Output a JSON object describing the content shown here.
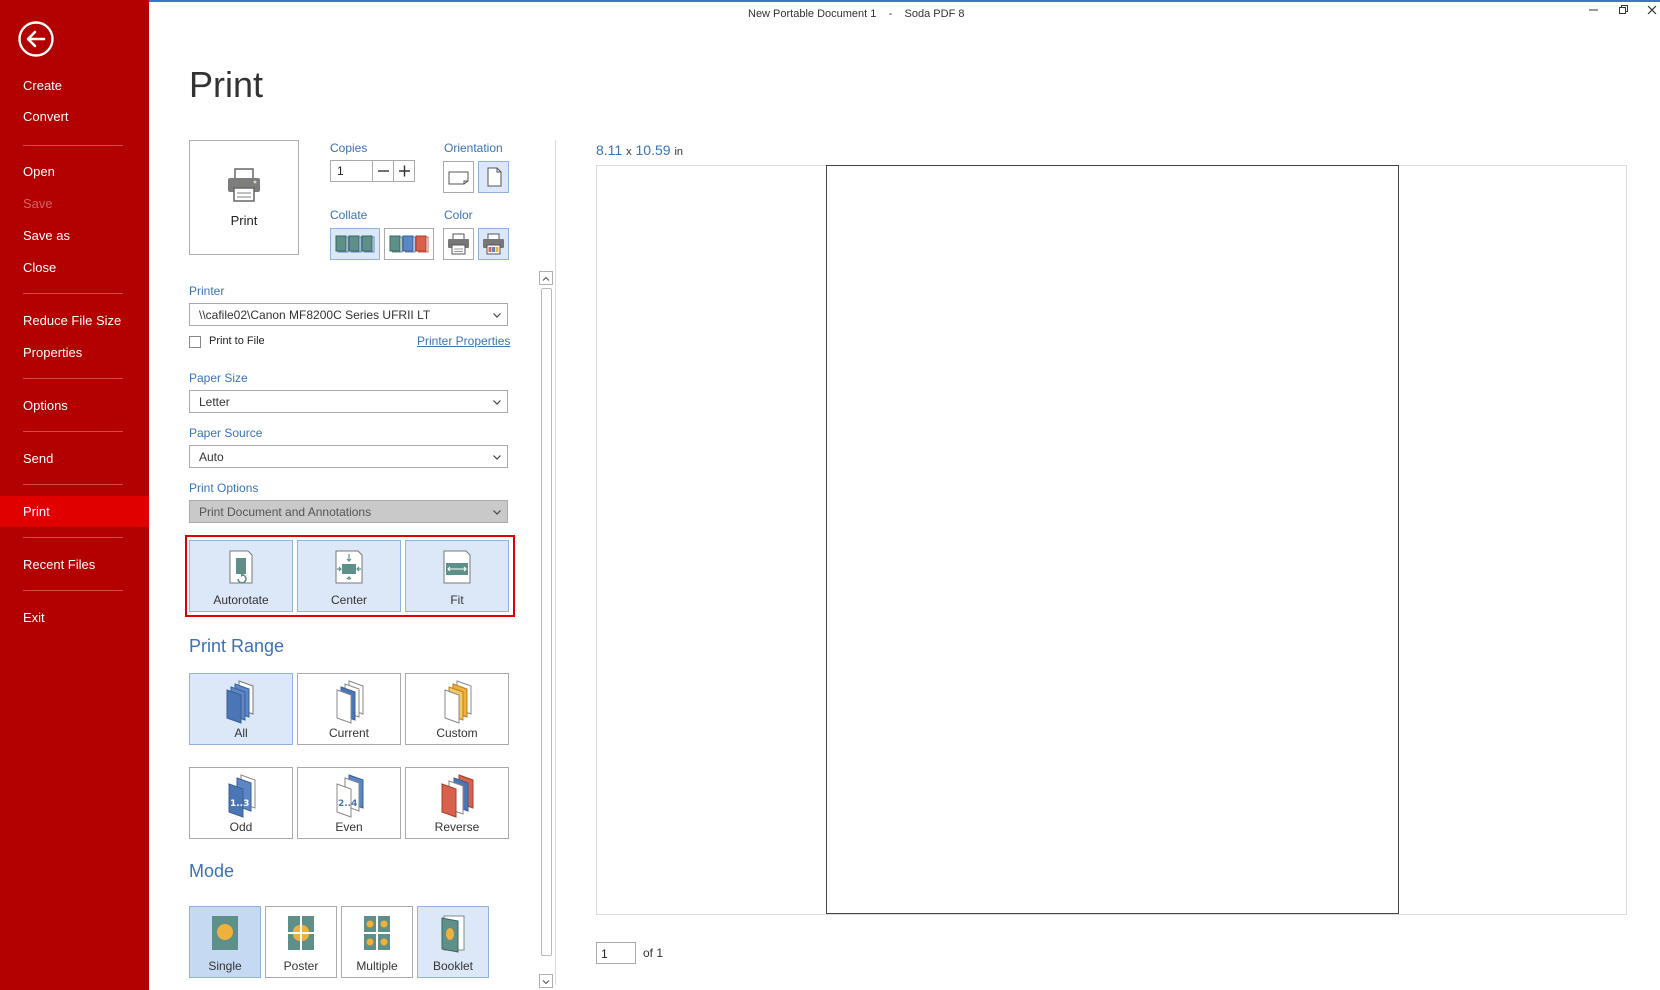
{
  "window": {
    "document_name": "New Portable Document 1",
    "separator": "-",
    "app_name": "Soda PDF 8"
  },
  "sidebar": {
    "items": [
      {
        "label": "Create",
        "enabled": true
      },
      {
        "label": "Convert",
        "enabled": true
      },
      {
        "label": "Open",
        "enabled": true
      },
      {
        "label": "Save",
        "enabled": false
      },
      {
        "label": "Save as",
        "enabled": true
      },
      {
        "label": "Close",
        "enabled": true
      },
      {
        "label": "Reduce File Size",
        "enabled": true
      },
      {
        "label": "Properties",
        "enabled": true
      },
      {
        "label": "Options",
        "enabled": true
      },
      {
        "label": "Send",
        "enabled": true
      },
      {
        "label": "Print",
        "enabled": true,
        "active": true
      },
      {
        "label": "Recent Files",
        "enabled": true
      },
      {
        "label": "Exit",
        "enabled": true
      }
    ],
    "colors": {
      "background": "#b30000",
      "active": "#e00000"
    }
  },
  "print_panel": {
    "title": "Print",
    "print_button_label": "Print",
    "copies": {
      "label": "Copies",
      "value": "1"
    },
    "orientation": {
      "label": "Orientation",
      "selected": "portrait"
    },
    "collate": {
      "label": "Collate",
      "selected": "collated"
    },
    "color": {
      "label": "Color",
      "selected": "color"
    },
    "printer": {
      "label": "Printer",
      "value": "\\\\cafile02\\Canon MF8200C Series UFRII LT",
      "print_to_file_label": "Print to File",
      "print_to_file_checked": false,
      "properties_link": "Printer Properties"
    },
    "paper_size": {
      "label": "Paper Size",
      "value": "Letter"
    },
    "paper_source": {
      "label": "Paper Source",
      "value": "Auto"
    },
    "print_options": {
      "label": "Print Options",
      "value": "Print Document and Annotations"
    },
    "layout_options": [
      {
        "label": "Autorotate",
        "selected": true
      },
      {
        "label": "Center",
        "selected": true
      },
      {
        "label": "Fit",
        "selected": true
      }
    ],
    "print_range": {
      "title": "Print Range",
      "options": [
        {
          "label": "All",
          "selected": true
        },
        {
          "label": "Current",
          "selected": false
        },
        {
          "label": "Custom",
          "selected": false
        },
        {
          "label": "Odd",
          "selected": false
        },
        {
          "label": "Even",
          "selected": false
        },
        {
          "label": "Reverse",
          "selected": false
        }
      ]
    },
    "mode": {
      "title": "Mode",
      "options": [
        {
          "label": "Single",
          "selected": true
        },
        {
          "label": "Poster",
          "selected": false
        },
        {
          "label": "Multiple",
          "selected": false
        },
        {
          "label": "Booklet",
          "selected": false
        }
      ]
    }
  },
  "preview": {
    "width": "8.11",
    "x": "x",
    "height": "10.59",
    "unit": "in",
    "page_input": "1",
    "page_total_label": "of 1"
  },
  "colors": {
    "accent_blue": "#3a72b9",
    "selected_tile": "#dce8f8",
    "highlight_red": "#e00000"
  }
}
